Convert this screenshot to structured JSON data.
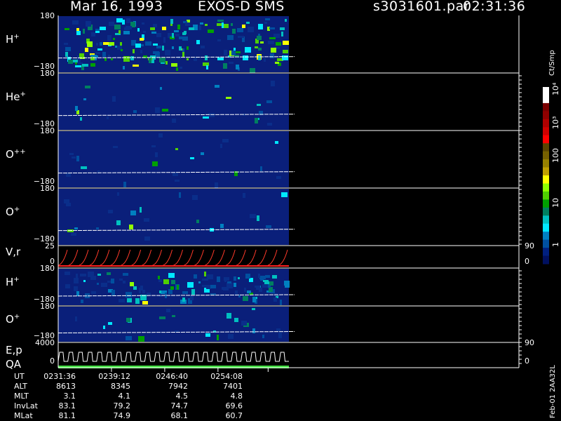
{
  "header": {
    "date": "Mar 16, 1993",
    "mission": "EXOS-D SMS",
    "file": "s3031601.par",
    "time": "02:31:36"
  },
  "colorbar": {
    "unit": "Ct/Smp",
    "ticks": [
      "10⁴",
      "10³",
      "100",
      "10",
      "1"
    ],
    "colors": [
      "#ffffff",
      "#ffffff",
      "#7a0000",
      "#900000",
      "#b00000",
      "#d00000",
      "#ff0000",
      "#5a4400",
      "#766000",
      "#968000",
      "#c0a000",
      "#ffff00",
      "#90ff00",
      "#50d000",
      "#00a000",
      "#008060",
      "#00c0c0",
      "#00e8ff",
      "#0080c0",
      "#0050a0",
      "#002080",
      "#001060"
    ]
  },
  "side_credit": "Feb-01 2AA32L",
  "chart_data": {
    "type": "heatmap",
    "panels": [
      {
        "name": "H+",
        "label_main": "H",
        "label_sup": "+",
        "kind": "heatmap",
        "ytop": "180",
        "ybot": "−180",
        "ylim": [
          -180,
          180
        ]
      },
      {
        "name": "He+",
        "label_main": "He",
        "label_sup": "+",
        "kind": "heatmap",
        "ytop": "180",
        "ybot": "−180",
        "ylim": [
          -180,
          180
        ]
      },
      {
        "name": "O++",
        "label_main": "O",
        "label_sup": "++",
        "kind": "heatmap",
        "ytop": "180",
        "ybot": "−180",
        "ylim": [
          -180,
          180
        ]
      },
      {
        "name": "O+",
        "label_main": "O",
        "label_sup": "+",
        "kind": "heatmap",
        "ytop": "180",
        "ybot": "−180",
        "ylim": [
          -180,
          180
        ]
      },
      {
        "name": "V,r",
        "label_main": "V,r",
        "label_sup": "",
        "kind": "line",
        "ytop": "25",
        "ybot": "0",
        "rtop": "90",
        "rbot": "0"
      },
      {
        "name": "H+ (2)",
        "label_main": "H",
        "label_sup": "+",
        "kind": "heatmap",
        "ytop": "180",
        "ybot": "−180",
        "ylim": [
          -180,
          180
        ]
      },
      {
        "name": "O+ (2)",
        "label_main": "O",
        "label_sup": "+",
        "kind": "heatmap",
        "ytop": "180",
        "ybot": "−180",
        "ylim": [
          -180,
          180
        ]
      },
      {
        "name": "E,p QA",
        "label_main": "E,p",
        "label_sup": "",
        "kind": "line",
        "ytop": "4000",
        "ybot": "0",
        "rtop": "90",
        "rbot": "0"
      }
    ],
    "qa_label": "QA",
    "data_fraction": 0.5,
    "ephemeris": {
      "rows": [
        {
          "name": "UT",
          "values": [
            "0231:36",
            "0239:12",
            "0246:40",
            "0254:08"
          ]
        },
        {
          "name": "ALT",
          "values": [
            "8613",
            "8345",
            "7942",
            "7401"
          ]
        },
        {
          "name": "MLT",
          "values": [
            "3.1",
            "4.1",
            "4.5",
            "4.8"
          ]
        },
        {
          "name": "InvLat",
          "values": [
            "83.1",
            "79.2",
            "74.7",
            "69.6"
          ]
        },
        {
          "name": "MLat",
          "values": [
            "81.1",
            "74.9",
            "68.1",
            "60.7"
          ]
        }
      ]
    }
  }
}
